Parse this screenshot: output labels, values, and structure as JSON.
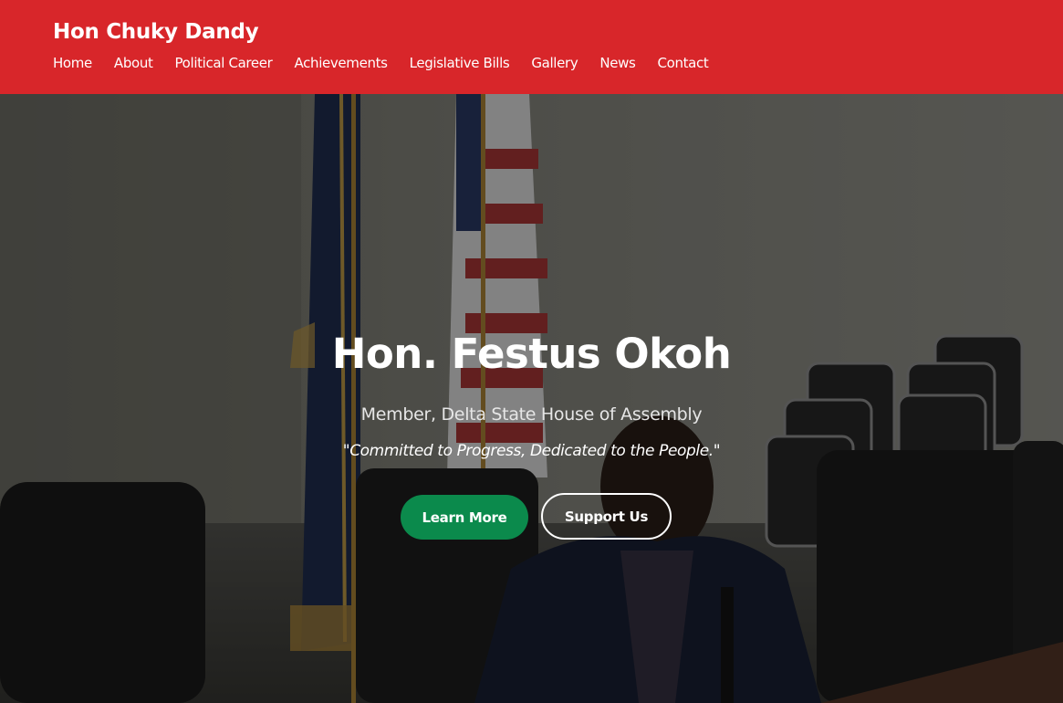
{
  "header": {
    "brand": "Hon Chuky Dandy",
    "background_color": "#d8262a",
    "nav": [
      {
        "label": "Home"
      },
      {
        "label": "About"
      },
      {
        "label": "Political Career"
      },
      {
        "label": "Achievements"
      },
      {
        "label": "Legislative Bills"
      },
      {
        "label": "Gallery"
      },
      {
        "label": "News"
      },
      {
        "label": "Contact"
      }
    ]
  },
  "hero": {
    "title": "Hon. Festus Okoh",
    "subtitle": "Member, Delta State House of Assembly",
    "quote": "\"Committed to Progress, Dedicated to the People.\"",
    "primary_button": "Learn More",
    "secondary_button": "Support Us",
    "primary_button_color": "#0b8a4c"
  }
}
